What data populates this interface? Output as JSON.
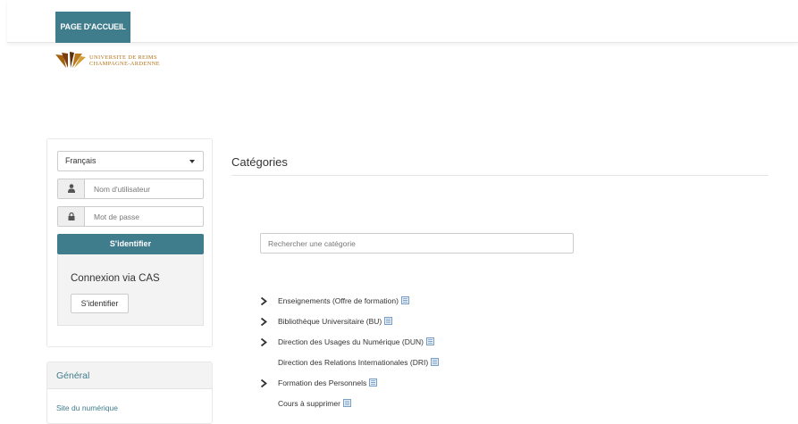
{
  "header": {
    "home_label": "PAGE D'ACCUEIL",
    "logo_line1": "UNIVERSITE DE REIMS",
    "logo_line2": "CHAMPAGNE-ARDENNE"
  },
  "login": {
    "language": "Français",
    "username_placeholder": "Nom d'utilisateur",
    "password_placeholder": "Mot de passe",
    "login_label": "S'identifier",
    "cas_title": "Connexion via CAS",
    "cas_button_label": "S'identifier"
  },
  "general": {
    "title": "Général",
    "link": "Site du numérique"
  },
  "main": {
    "title": "Catégories",
    "search_placeholder": "Rechercher une catégorie",
    "categories": [
      {
        "label": "Enseignements (Offre de formation)",
        "expandable": true
      },
      {
        "label": "Bibliothèque Universitaire (BU)",
        "expandable": true
      },
      {
        "label": "Direction des Usages du Numérique (DUN)",
        "expandable": true
      },
      {
        "label": "Direction des Relations Internationales (DRI)",
        "expandable": false
      },
      {
        "label": "Formation des Personnels",
        "expandable": true
      },
      {
        "label": "Cours à supprimer",
        "expandable": false
      }
    ]
  },
  "icons": {
    "user": "user-icon",
    "lock": "lock-icon",
    "chevron": "chevron-right-icon",
    "description": "description-icon"
  },
  "colors": {
    "accent": "#3f7c8c",
    "logo": "#b3731c"
  }
}
